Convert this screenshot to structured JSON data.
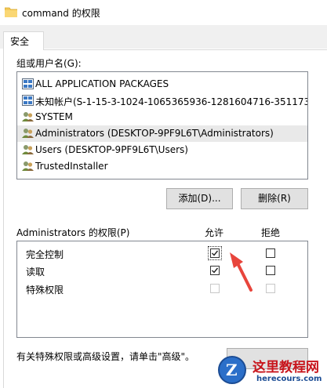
{
  "window": {
    "title": "command 的权限",
    "icon": "folder-icon"
  },
  "tabs": [
    {
      "label": "安全"
    }
  ],
  "groups_label": "组或用户名(G):",
  "principals": [
    {
      "name": "ALL APPLICATION PACKAGES",
      "icon": "app-packages-icon",
      "selected": false
    },
    {
      "name": "未知帐户(S-1-15-3-1024-1065365936-1281604716-351173...",
      "icon": "unknown-account-icon",
      "selected": false
    },
    {
      "name": "SYSTEM",
      "icon": "users-icon",
      "selected": false
    },
    {
      "name": "Administrators (DESKTOP-9PF9L6T\\Administrators)",
      "icon": "users-icon",
      "selected": true
    },
    {
      "name": "Users (DESKTOP-9PF9L6T\\Users)",
      "icon": "users-icon",
      "selected": false
    },
    {
      "name": "TrustedInstaller",
      "icon": "users-icon",
      "selected": false
    }
  ],
  "buttons": {
    "add": "添加(D)...",
    "remove": "删除(R)"
  },
  "permissions_label": "Administrators 的权限(P)",
  "allow_header": "允许",
  "deny_header": "拒绝",
  "permissions": [
    {
      "name": "完全控制",
      "allow": true,
      "deny": false,
      "enabled": true
    },
    {
      "name": "读取",
      "allow": true,
      "deny": false,
      "enabled": true
    },
    {
      "name": "特殊权限",
      "allow": false,
      "deny": false,
      "enabled": false
    }
  ],
  "advanced_note": "有关特殊权限或高级设置，请单击\"高级\"。",
  "watermark": {
    "title": "这里教程网",
    "url": "herecours.com",
    "logo_letter": "Z"
  },
  "colors": {
    "selection": "#e9e9e9",
    "arrow": "#e8453c",
    "button_face": "#e1e1e1",
    "watermark_red": "#c8161d",
    "watermark_blue": "#1b4c94"
  }
}
